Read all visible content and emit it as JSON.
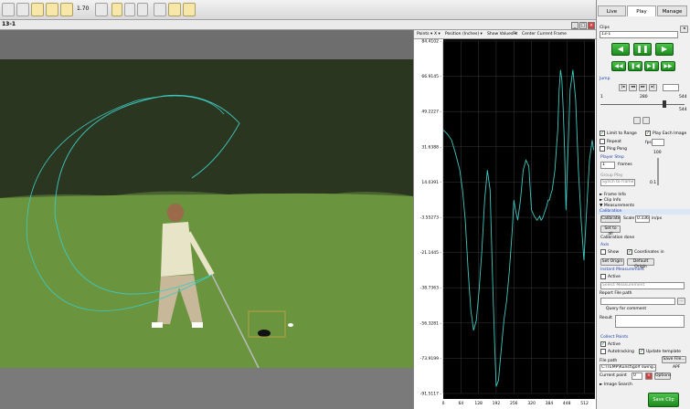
{
  "toolbar": {
    "zoom": "1.70",
    "icons": [
      "grid-icon",
      "layers-icon",
      "tools-icon",
      "frame-icon",
      "zoom-icon",
      "crosshair-icon",
      "annotate-icon",
      "help-icon"
    ]
  },
  "clip_label": "13-1",
  "chart": {
    "header": {
      "points": "Points ▾",
      "axis": "X ▾",
      "position": "Position (Inches) ▾",
      "show_values": "Show Values ▾",
      "fit": "Fit",
      "center": "Center Current Frame"
    },
    "y_ticks": [
      "84.4102 -",
      "66.9145 -",
      "49.2227 -",
      "31.6388 -",
      "14.0391 -",
      "-3.55273 -",
      "-21.1445 -",
      "-38.7363 -",
      "-56.3281 -",
      "-73.9199 -",
      "-91.5117 -"
    ],
    "x_ticks": [
      "0",
      "64",
      "128",
      "192",
      "256",
      "320",
      "384",
      "448",
      "512"
    ],
    "line_color": "#3fc8c0"
  },
  "chart_data": {
    "type": "line",
    "title": "",
    "xlabel": "",
    "ylabel": "",
    "xlim": [
      0,
      550
    ],
    "ylim": [
      -91.5117,
      84.4102
    ],
    "grid": true,
    "series": [
      {
        "x": [
          0,
          15,
          30,
          45,
          60,
          70,
          80,
          90,
          100,
          110,
          120,
          130,
          140,
          150,
          160,
          170,
          178,
          186,
          192,
          200,
          210,
          220,
          230,
          240,
          250,
          256,
          262,
          270,
          280,
          290,
          300,
          310,
          320,
          330,
          340,
          350,
          355,
          360,
          365,
          370,
          375,
          380,
          385,
          390,
          395,
          400,
          405,
          410,
          415,
          420,
          425,
          430,
          435,
          440,
          445,
          450,
          455,
          460,
          470,
          480,
          490,
          500,
          510,
          520,
          530,
          540,
          545
        ],
        "values": [
          40,
          38,
          35,
          28,
          20,
          10,
          -5,
          -30,
          -50,
          -60,
          -55,
          -40,
          -20,
          5,
          20,
          10,
          -30,
          -65,
          -88,
          -85,
          -70,
          -55,
          -45,
          -30,
          -10,
          5,
          0,
          -5,
          5,
          20,
          25,
          22,
          0,
          -3,
          -5,
          -3,
          -5,
          -4,
          -2,
          0,
          2,
          5,
          5,
          8,
          10,
          15,
          20,
          30,
          40,
          60,
          70,
          65,
          50,
          30,
          0,
          20,
          40,
          60,
          70,
          55,
          20,
          -5,
          -25,
          0,
          25,
          35,
          30
        ]
      }
    ]
  },
  "panel": {
    "tabs": [
      "Live",
      "Play",
      "Manage"
    ],
    "clips_label": "Clips",
    "clip_value": "13-1",
    "transport": [
      "◀",
      "❚❚",
      "▶",
      "◀◀",
      "❚◀",
      "▶❚",
      "▶▶"
    ],
    "jump_label": "Jump",
    "slider_min": "1",
    "slider_mid": "280",
    "slider_max": "544",
    "slider_end": "544",
    "limit_to_range": "Limit to Range",
    "play_each": "Play Each Image",
    "repeat": "Repeat",
    "ping_pong": "Ping Pong",
    "fps_label": "fps",
    "player_step": "Player Step",
    "step_value": "1",
    "step_unit": "frames",
    "fps_100": "100",
    "group_play": "Group Play",
    "sync_label": "Synch to frame #",
    "speed": "0.1",
    "frame_info": "► Frame Info",
    "clip_info": "► Clip Info",
    "measurements": "▼ Measurements",
    "calibration": "Calibration",
    "calibrate_btn": "Calibrate",
    "scale_label": "Scale",
    "scale_value": "0.336",
    "scale_unit": "in/px",
    "set_all": "Set to all",
    "calib_done": "Calibration done",
    "axis": "Axis",
    "show": "Show",
    "coords_in": "Coordinates in",
    "set_origin": "Set Origin",
    "default_origin": "Default Origin",
    "instant_measure": "Instant Measurement",
    "active": "Active",
    "select_measure": "Select Measurement",
    "report_path": "Report File path",
    "query_comment": "Query for comment",
    "result": "Result",
    "collect_points": "Collect Points",
    "active2": "Active",
    "autotracking": "Autotracking",
    "update_template": "Update template",
    "file_path": "File path",
    "save_file": "Save File...",
    "file_value": "C:\\TEMP\\Kunst\\golf swing.aif",
    "apf": "APF",
    "current_point": "Current point",
    "point_value": "0",
    "options": "Options",
    "image_search": "► Image Search",
    "save_btn": "Save Clip"
  }
}
